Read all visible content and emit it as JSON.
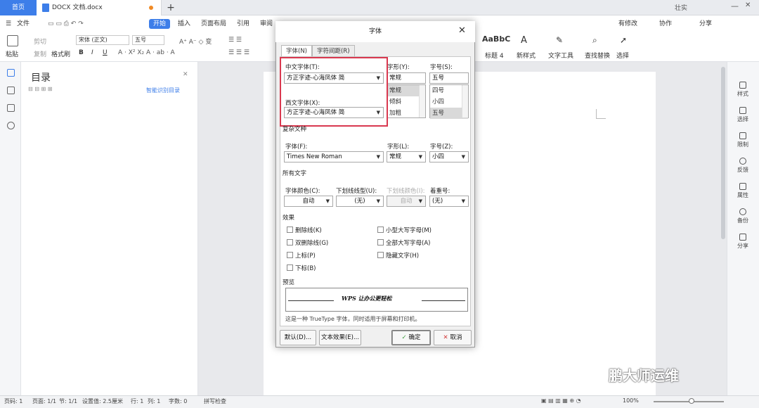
{
  "tabs": {
    "home": "首页",
    "doc": "DOCX 文档.docx",
    "new": "+"
  },
  "topbar": {
    "account": "壮实"
  },
  "ribbon": {
    "file": "文件",
    "tabs": [
      "开始",
      "插入",
      "页面布局",
      "引用",
      "审阅"
    ],
    "actions": [
      "有修改",
      "协作",
      "分享"
    ]
  },
  "toolbar": {
    "paste": "粘贴",
    "cut": "剪切",
    "copy": "复制",
    "format_painter": "格式刷",
    "font_name": "宋体 (正文)",
    "font_size": "五号",
    "style_preview": "AaBbC",
    "style_name": "标题 4",
    "new_style": "新样式",
    "text_tools": "文字工具",
    "find_replace": "查找替换",
    "select": "选择"
  },
  "toc": {
    "title": "目录",
    "smart": "智能识别目录"
  },
  "right_panel": [
    "样式",
    "选择",
    "限制",
    "反馈",
    "属性",
    "备份",
    "分享"
  ],
  "dialog": {
    "title": "字体",
    "tabs": [
      "字体(N)",
      "字符间距(R)"
    ],
    "chinese_font_label": "中文字体(T):",
    "chinese_font": "方正字迹-心海凤体 简",
    "western_font_label": "西文字体(X):",
    "western_font": "方正字迹-心海凤体 简",
    "style_label": "字形(Y):",
    "style_value": "常规",
    "style_options": [
      "常规",
      "倾斜",
      "加粗"
    ],
    "size_label": "字号(S):",
    "size_value": "五号",
    "size_options": [
      "四号",
      "小四",
      "五号"
    ],
    "complex_section": "复杂文种",
    "complex_font_label": "字体(F):",
    "complex_font": "Times New Roman",
    "complex_style_label": "字形(L):",
    "complex_style": "常规",
    "complex_size_label": "字号(Z):",
    "complex_size": "小四",
    "all_text": "所有文字",
    "color_label": "字体颜色(C):",
    "color_value": "自动",
    "underline_label": "下划线线型(U):",
    "underline_value": "(无)",
    "underline_color_label": "下划线颜色(I):",
    "underline_color_value": "自动",
    "emphasis_label": "着重号:",
    "emphasis_value": "(无)",
    "effects": "效果",
    "effects_left": [
      "删除线(K)",
      "双删除线(G)",
      "上标(P)",
      "下标(B)"
    ],
    "effects_right": [
      "小型大写字母(M)",
      "全部大写字母(A)",
      "隐藏文字(H)"
    ],
    "preview_label": "预览",
    "preview_text": "WPS 让办公更轻松",
    "truetype_note": "这是一种 TrueType 字体，同时适用于屏幕和打印机。",
    "default_btn": "默认(D)...",
    "text_effect_btn": "文本效果(E)...",
    "ok_btn": "确定",
    "cancel_btn": "取消"
  },
  "status": {
    "page": "页码: 1",
    "pages": "页面: 1/1",
    "section": "节: 1/1",
    "setting": "设置值: 2.5厘米",
    "row": "行: 1",
    "col": "列: 1",
    "words": "字数: 0",
    "spell": "拼写检查",
    "zoom": "100%"
  },
  "watermark": "鹏大师运维",
  "colors": {
    "accent": "#3d7ee9",
    "highlight": "#d9384f"
  }
}
